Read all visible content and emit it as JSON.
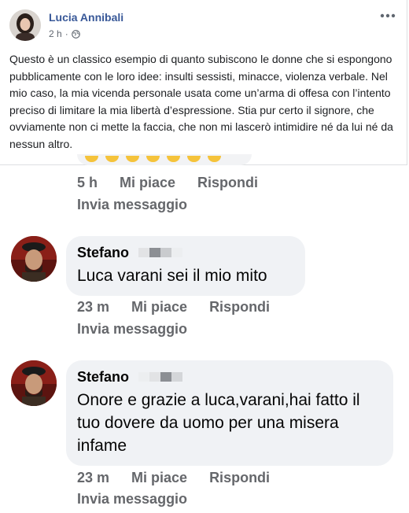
{
  "post": {
    "author": "Lucia Annibali",
    "time": "2 h",
    "separator": "·",
    "text": "Questo è un classico esempio di quanto subiscono le donne che si espongono pubblicamente con le loro idee: insulti sessisti, minacce, violenza verbale. Nel mio caso, la mia vicenda personale usata come un’arma di offesa con l’intento preciso di limitare la mia libertà d’espressione. Stia pur certo il signore, che ovviamente non ci mette la faccia, che non mi lascerò intimidire né da lui né da nessun altro."
  },
  "first_actions": {
    "time": "5 h",
    "like": "Mi piace",
    "reply": "Rispondi",
    "message": "Invia messaggio"
  },
  "comments": [
    {
      "name": "Stefano",
      "text": "Luca varani sei il mio mito",
      "time": "23 m",
      "like": "Mi piace",
      "reply": "Rispondi",
      "message": "Invia messaggio"
    },
    {
      "name": "Stefano",
      "text": "Onore e grazie a luca,varani,hai fatto il tuo dovere da uomo per una misera infame",
      "time": "23 m",
      "like": "Mi piace",
      "reply": "Rispondi",
      "message": "Invia messaggio"
    }
  ],
  "colors": {
    "author_link": "#385898",
    "action_gray": "#65676b",
    "bubble_bg": "#f0f2f5"
  },
  "icons": {
    "privacy": "globe-icon",
    "options": "more-options-icon"
  }
}
